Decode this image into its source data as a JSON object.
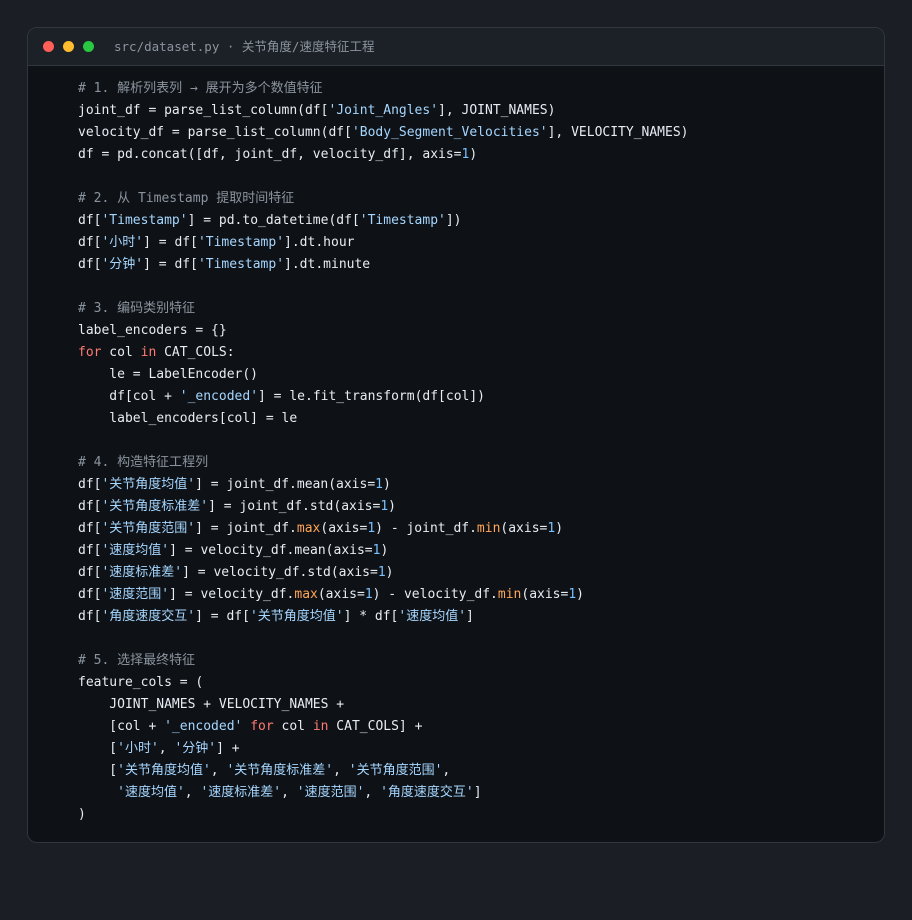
{
  "window": {
    "title": "src/dataset.py · 关节角度/速度特征工程",
    "traffic_lights": {
      "close_color": "#ff5f57",
      "minimize_color": "#febc2e",
      "maximize_color": "#28c840"
    }
  },
  "colors": {
    "background": "#0e1116",
    "comment": "#8b949e",
    "string": "#a5d6ff",
    "keyword": "#ff7b72",
    "number": "#79c0ff",
    "builtin": "#ffa657",
    "text": "#e6edf3"
  },
  "code_lines": [
    [
      [
        "comment",
        "# 1. 解析列表列 → 展开为多个数值特征"
      ]
    ],
    [
      [
        "plain",
        "joint_df = parse_list_column(df["
      ],
      [
        "string",
        "'Joint_Angles'"
      ],
      [
        "plain",
        "], JOINT_NAMES)"
      ]
    ],
    [
      [
        "plain",
        "velocity_df = parse_list_column(df["
      ],
      [
        "string",
        "'Body_Segment_Velocities'"
      ],
      [
        "plain",
        "], VELOCITY_NAMES)"
      ]
    ],
    [
      [
        "plain",
        "df = pd.concat([df, joint_df, velocity_df], axis="
      ],
      [
        "number",
        "1"
      ],
      [
        "plain",
        ")"
      ]
    ],
    [],
    [
      [
        "comment",
        "# 2. 从 Timestamp 提取时间特征"
      ]
    ],
    [
      [
        "plain",
        "df["
      ],
      [
        "string",
        "'Timestamp'"
      ],
      [
        "plain",
        "] = pd.to_datetime(df["
      ],
      [
        "string",
        "'Timestamp'"
      ],
      [
        "plain",
        "])"
      ]
    ],
    [
      [
        "plain",
        "df["
      ],
      [
        "string",
        "'小时'"
      ],
      [
        "plain",
        "] = df["
      ],
      [
        "string",
        "'Timestamp'"
      ],
      [
        "plain",
        "].dt.hour"
      ]
    ],
    [
      [
        "plain",
        "df["
      ],
      [
        "string",
        "'分钟'"
      ],
      [
        "plain",
        "] = df["
      ],
      [
        "string",
        "'Timestamp'"
      ],
      [
        "plain",
        "].dt.minute"
      ]
    ],
    [],
    [
      [
        "comment",
        "# 3. 编码类别特征"
      ]
    ],
    [
      [
        "plain",
        "label_encoders = {}"
      ]
    ],
    [
      [
        "keyword",
        "for"
      ],
      [
        "plain",
        " col "
      ],
      [
        "keyword",
        "in"
      ],
      [
        "plain",
        " CAT_COLS:"
      ]
    ],
    [
      [
        "plain",
        "    le = LabelEncoder()"
      ]
    ],
    [
      [
        "plain",
        "    df[col + "
      ],
      [
        "string",
        "'_encoded'"
      ],
      [
        "plain",
        "] = le.fit_transform(df[col])"
      ]
    ],
    [
      [
        "plain",
        "    label_encoders[col] = le"
      ]
    ],
    [],
    [
      [
        "comment",
        "# 4. 构造特征工程列"
      ]
    ],
    [
      [
        "plain",
        "df["
      ],
      [
        "string",
        "'关节角度均值'"
      ],
      [
        "plain",
        "] = joint_df.mean(axis="
      ],
      [
        "number",
        "1"
      ],
      [
        "plain",
        ")"
      ]
    ],
    [
      [
        "plain",
        "df["
      ],
      [
        "string",
        "'关节角度标准差'"
      ],
      [
        "plain",
        "] = joint_df.std(axis="
      ],
      [
        "number",
        "1"
      ],
      [
        "plain",
        ")"
      ]
    ],
    [
      [
        "plain",
        "df["
      ],
      [
        "string",
        "'关节角度范围'"
      ],
      [
        "plain",
        "] = joint_df."
      ],
      [
        "builtin",
        "max"
      ],
      [
        "plain",
        "(axis="
      ],
      [
        "number",
        "1"
      ],
      [
        "plain",
        ") - joint_df."
      ],
      [
        "builtin",
        "min"
      ],
      [
        "plain",
        "(axis="
      ],
      [
        "number",
        "1"
      ],
      [
        "plain",
        ")"
      ]
    ],
    [
      [
        "plain",
        "df["
      ],
      [
        "string",
        "'速度均值'"
      ],
      [
        "plain",
        "] = velocity_df.mean(axis="
      ],
      [
        "number",
        "1"
      ],
      [
        "plain",
        ")"
      ]
    ],
    [
      [
        "plain",
        "df["
      ],
      [
        "string",
        "'速度标准差'"
      ],
      [
        "plain",
        "] = velocity_df.std(axis="
      ],
      [
        "number",
        "1"
      ],
      [
        "plain",
        ")"
      ]
    ],
    [
      [
        "plain",
        "df["
      ],
      [
        "string",
        "'速度范围'"
      ],
      [
        "plain",
        "] = velocity_df."
      ],
      [
        "builtin",
        "max"
      ],
      [
        "plain",
        "(axis="
      ],
      [
        "number",
        "1"
      ],
      [
        "plain",
        ") - velocity_df."
      ],
      [
        "builtin",
        "min"
      ],
      [
        "plain",
        "(axis="
      ],
      [
        "number",
        "1"
      ],
      [
        "plain",
        ")"
      ]
    ],
    [
      [
        "plain",
        "df["
      ],
      [
        "string",
        "'角度速度交互'"
      ],
      [
        "plain",
        "] = df["
      ],
      [
        "string",
        "'关节角度均值'"
      ],
      [
        "plain",
        "] * df["
      ],
      [
        "string",
        "'速度均值'"
      ],
      [
        "plain",
        "]"
      ]
    ],
    [],
    [
      [
        "comment",
        "# 5. 选择最终特征"
      ]
    ],
    [
      [
        "plain",
        "feature_cols = ("
      ]
    ],
    [
      [
        "plain",
        "    JOINT_NAMES + VELOCITY_NAMES +"
      ]
    ],
    [
      [
        "plain",
        "    [col + "
      ],
      [
        "string",
        "'_encoded'"
      ],
      [
        "plain",
        " "
      ],
      [
        "keyword",
        "for"
      ],
      [
        "plain",
        " col "
      ],
      [
        "keyword",
        "in"
      ],
      [
        "plain",
        " CAT_COLS] +"
      ]
    ],
    [
      [
        "plain",
        "    ["
      ],
      [
        "string",
        "'小时'"
      ],
      [
        "plain",
        ", "
      ],
      [
        "string",
        "'分钟'"
      ],
      [
        "plain",
        "] +"
      ]
    ],
    [
      [
        "plain",
        "    ["
      ],
      [
        "string",
        "'关节角度均值'"
      ],
      [
        "plain",
        ", "
      ],
      [
        "string",
        "'关节角度标准差'"
      ],
      [
        "plain",
        ", "
      ],
      [
        "string",
        "'关节角度范围'"
      ],
      [
        "plain",
        ","
      ]
    ],
    [
      [
        "plain",
        "     "
      ],
      [
        "string",
        "'速度均值'"
      ],
      [
        "plain",
        ", "
      ],
      [
        "string",
        "'速度标准差'"
      ],
      [
        "plain",
        ", "
      ],
      [
        "string",
        "'速度范围'"
      ],
      [
        "plain",
        ", "
      ],
      [
        "string",
        "'角度速度交互'"
      ],
      [
        "plain",
        "]"
      ]
    ],
    [
      [
        "plain",
        ")"
      ]
    ]
  ]
}
